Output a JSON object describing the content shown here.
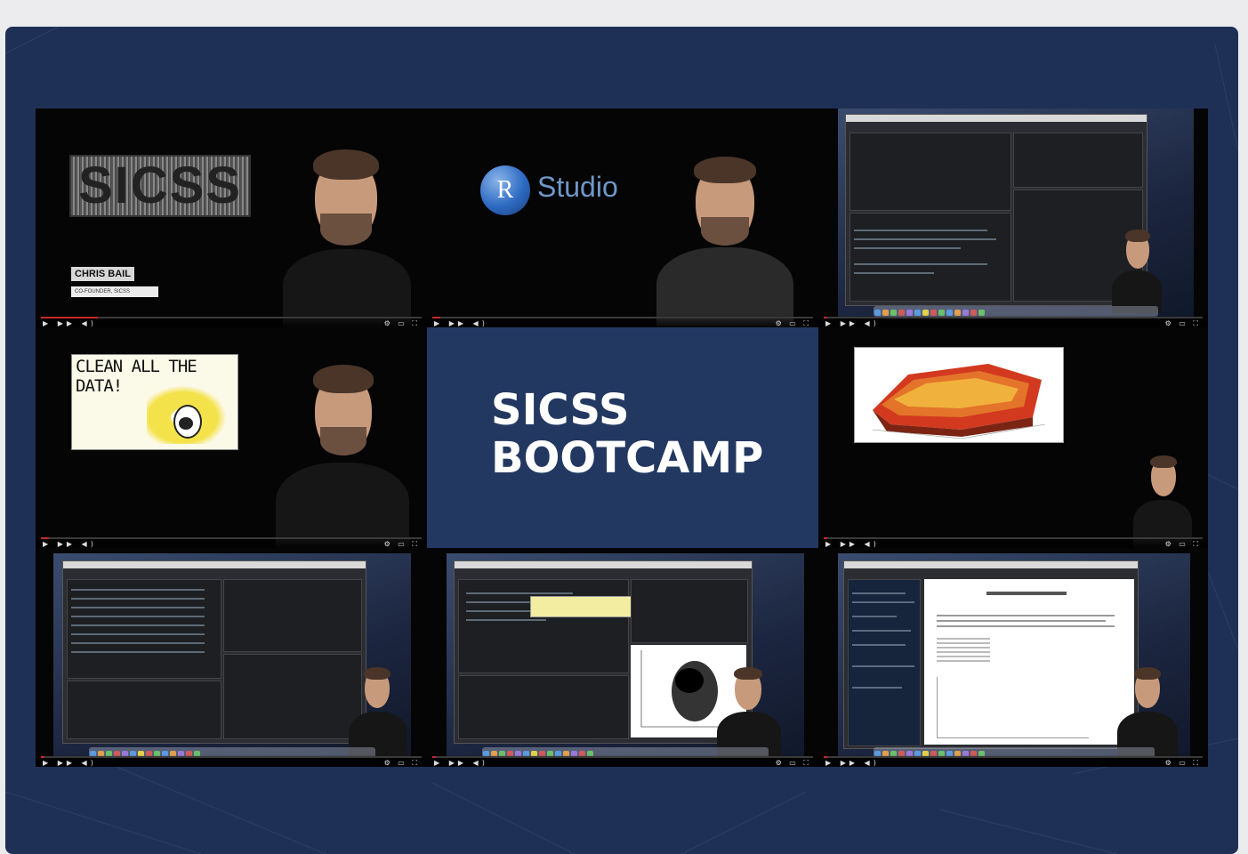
{
  "card": {
    "title": "SICSS BOOTCAMP",
    "title_line1": "SICSS",
    "title_line2": "BOOTCAMP",
    "background_color": "#1f3056"
  },
  "tiles": {
    "t1": {
      "logo_text": "SICSS",
      "presenter_name": "CHRIS BAIL",
      "presenter_title": "CO-FOUNDER, SICSS",
      "progress": 0.15
    },
    "t2": {
      "logo_letter": "R",
      "logo_text": "Studio",
      "progress": 0.02
    },
    "t3": {
      "progress": 0.01
    },
    "t4": {
      "meme_text_line1": "CLEAN ALL THE",
      "meme_text_line2": "DATA!",
      "progress": 0.02
    },
    "t6": {
      "progress": 0.01
    },
    "t7": {
      "progress": 0.01
    },
    "t8": {
      "progress": 0.01
    },
    "t9": {
      "progress": 0.01
    }
  },
  "colors": {
    "accent_red": "#c62828",
    "rstudio_blue": "#6f97c8",
    "tile_center": "#233861"
  },
  "icons": {
    "player_controls": "play-pause-skip-volume",
    "player_right": "settings-fullscreen"
  }
}
